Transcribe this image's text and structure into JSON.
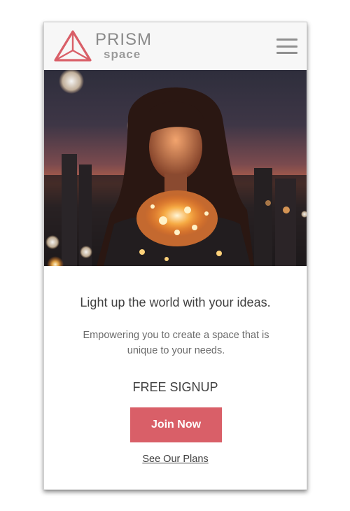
{
  "header": {
    "brand_name": "PRISM",
    "brand_sub": "space",
    "logo_icon": "prism-triangle-logo",
    "menu_icon": "hamburger-menu-icon",
    "logo_color": "#d95f68"
  },
  "hero": {
    "image_description_icon": "woman-holding-string-lights-photo"
  },
  "main": {
    "headline": "Light up the world with your ideas.",
    "subtext": "Empowering you to create a space that is unique to your needs.",
    "signup_label": "FREE SIGNUP",
    "join_button_label": "Join Now",
    "plans_link_label": "See Our Plans"
  },
  "colors": {
    "accent": "#d95f68",
    "text_dark": "#3f3f3f",
    "text_muted": "#6b6b6b",
    "header_bg": "#f7f7f7"
  }
}
